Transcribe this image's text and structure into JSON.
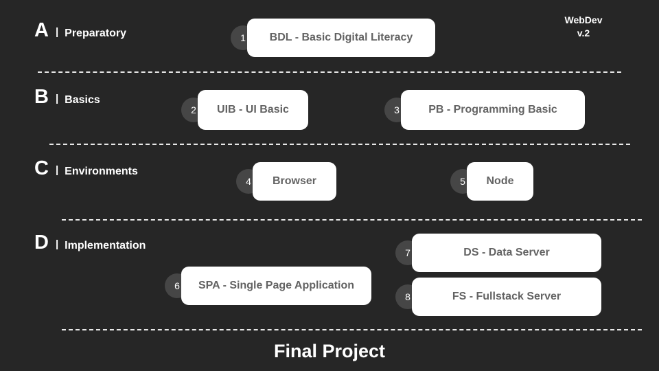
{
  "meta": {
    "version_label_line1": "WebDev",
    "version_label_line2": "v.2",
    "separator": "|"
  },
  "sections": [
    {
      "letter": "A",
      "title": "Preparatory",
      "nodes": [
        {
          "number": "1",
          "label": "BDL - Basic Digital Literacy"
        }
      ]
    },
    {
      "letter": "B",
      "title": "Basics",
      "nodes": [
        {
          "number": "2",
          "label": "UIB - UI Basic"
        },
        {
          "number": "3",
          "label": "PB - Programming Basic"
        }
      ]
    },
    {
      "letter": "C",
      "title": "Environments",
      "nodes": [
        {
          "number": "4",
          "label": "Browser"
        },
        {
          "number": "5",
          "label": "Node"
        }
      ]
    },
    {
      "letter": "D",
      "title": "Implementation",
      "nodes": [
        {
          "number": "6",
          "label": "SPA - Single Page Application"
        },
        {
          "number": "7",
          "label": "DS - Data Server"
        },
        {
          "number": "8",
          "label": "FS - Fullstack Server"
        }
      ]
    }
  ],
  "footer": {
    "title": "Final Project"
  },
  "colors": {
    "background": "#262626",
    "pill_background": "#ffffff",
    "pill_text": "#636363",
    "badge_background": "#464646",
    "badge_text": "#ffffff",
    "heading_text": "#ffffff",
    "divider": "#e8e8e8"
  }
}
